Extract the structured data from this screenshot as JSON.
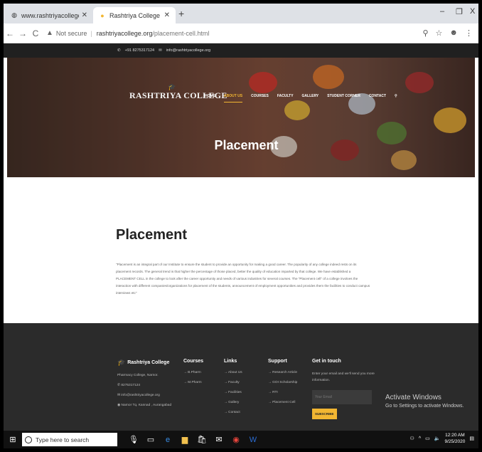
{
  "browser": {
    "tabs": [
      {
        "title": "www.rashtriyacollege.org",
        "active": false
      },
      {
        "title": "Rashtriya College of Pharmacy -",
        "active": true
      }
    ],
    "new_tab": "+",
    "window_controls": {
      "minimize": "–",
      "restore": "❐",
      "close": "X"
    },
    "nav": {
      "back": "←",
      "forward": "→",
      "reload": "C"
    },
    "security": "Not secure",
    "url_host": "rashtriyacollege.org",
    "url_path": "/placement-cell.html"
  },
  "site": {
    "topbar": {
      "phone": "+91 8275317124",
      "email": "info@rashtriyacollege.org"
    },
    "logo_text": "RASHTRIYA COLLEGE",
    "menu": [
      "HOME",
      "ABOUT US",
      "COURSES",
      "FACULTY",
      "GALLERY",
      "STUDENT CORNER",
      "CONTACT"
    ],
    "menu_selected": "ABOUT US",
    "hero_title": "Placement",
    "content": {
      "heading": "Placement",
      "paragraph": "\"Placement is an integral part of our Institute to ensure the student to provide an opportunity for making a good career. The popularity of any college indeed rests on its placement records. The general trend is that higher the percentage of those placed, better the quality of education imparted by that college. We have established a PLACEMENT CELL in the college to look after the career opportunity and needs of various industries for several courses. The \"Placement cell\" of a college involves the interaction with different companies/organizations for placement of the students, announcement of employment opportunities and provides them the facilities to conduct campus interviews etc\""
    },
    "footer": {
      "brand": {
        "name": "Rashtriya College",
        "lines": [
          "Pharmacy College, Narnor.",
          "8275317124",
          "info@rashtriyacollege.org",
          "Narnor Tq. Kannad , Aurangabad"
        ]
      },
      "courses": {
        "title": "Courses",
        "items": [
          "→ B.Pharm",
          "→ M.Pharm"
        ]
      },
      "links": {
        "title": "Links",
        "items": [
          "→ About Us",
          "→ Faculty",
          "→ Facilities",
          "→ Gallery",
          "→ Contact"
        ]
      },
      "support": {
        "title": "Support",
        "items": [
          "→ Research Article",
          "→ GOI Scholarship",
          "→ RTI",
          "→ Placement Cell"
        ]
      },
      "touch": {
        "title": "Get in touch",
        "text": "Enter your email and we'll send you more information.",
        "placeholder": "Your Email",
        "button": "SUBSCRIBE"
      }
    }
  },
  "watermark": {
    "line1": "Activate Windows",
    "line2": "Go to Settings to activate Windows."
  },
  "taskbar": {
    "search_placeholder": "Type here to search",
    "time": "12:20 AM",
    "date": "9/25/2020"
  }
}
